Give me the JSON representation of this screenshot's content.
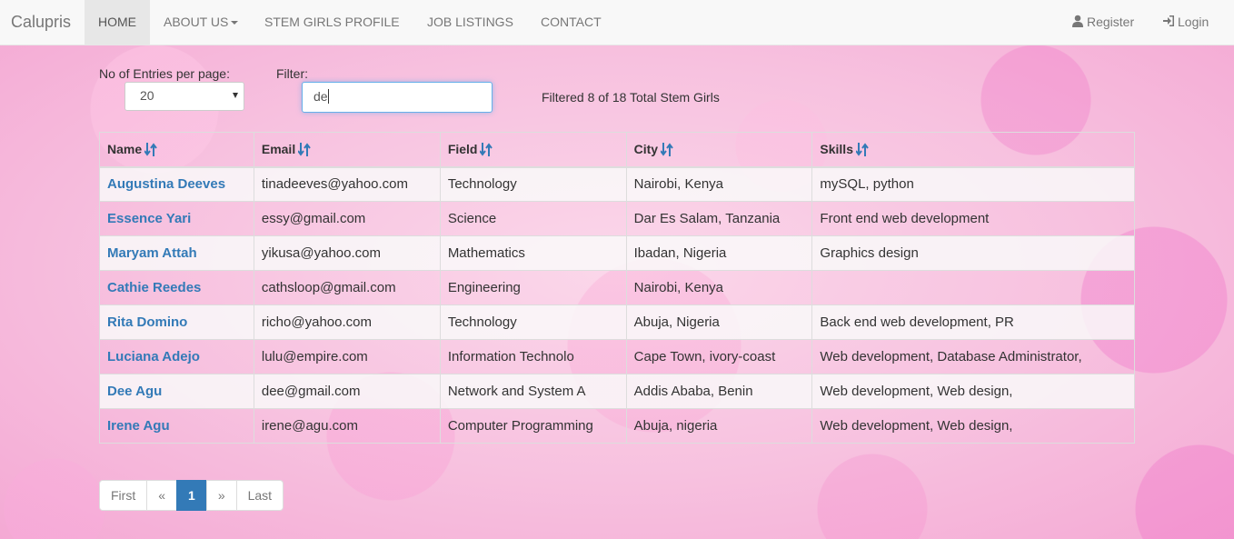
{
  "navbar": {
    "brand": "Calupris",
    "items": [
      {
        "label": "HOME"
      },
      {
        "label": "ABOUT US"
      },
      {
        "label": "STEM GIRLS PROFILE"
      },
      {
        "label": "JOB LISTINGS"
      },
      {
        "label": "CONTACT"
      }
    ],
    "register_label": "Register",
    "register_icon": "user-icon",
    "login_label": "Login",
    "login_icon": "sign-in-icon"
  },
  "controls": {
    "entries_label": "No of Entries per page:",
    "entries_value": "20",
    "filter_label": "Filter:",
    "filter_value": "de",
    "status": "Filtered 8 of 18 Total Stem Girls"
  },
  "table": {
    "headers": [
      "Name",
      "Email",
      "Field",
      "City",
      "Skills"
    ],
    "sort_icon": "sort-icon",
    "rows": [
      {
        "name": "Augustina Deeves",
        "email": "tinadeeves@yahoo.com",
        "field": "Technology",
        "city": "Nairobi, Kenya",
        "skills": "mySQL, python"
      },
      {
        "name": "Essence Yari",
        "email": "essy@gmail.com",
        "field": "Science",
        "city": "Dar Es Salam, Tanzania",
        "skills": "Front end web development"
      },
      {
        "name": "Maryam Attah",
        "email": "yikusa@yahoo.com",
        "field": "Mathematics",
        "city": "Ibadan, Nigeria",
        "skills": "Graphics design"
      },
      {
        "name": "Cathie Reedes",
        "email": "cathsloop@gmail.com",
        "field": "Engineering",
        "city": "Nairobi, Kenya",
        "skills": ""
      },
      {
        "name": "Rita Domino",
        "email": "richo@yahoo.com",
        "field": "Technology",
        "city": "Abuja, Nigeria",
        "skills": "Back end web development, PR"
      },
      {
        "name": "Luciana Adejo",
        "email": "lulu@empire.com",
        "field": "Information Technolo",
        "city": "Cape Town, ivory-coast",
        "skills": "Web development, Database Administrator,"
      },
      {
        "name": "Dee Agu",
        "email": "dee@gmail.com",
        "field": "Network and System A",
        "city": "Addis Ababa, Benin",
        "skills": "Web development, Web design,"
      },
      {
        "name": "Irene Agu",
        "email": "irene@agu.com",
        "field": "Computer Programming",
        "city": "Abuja, nigeria",
        "skills": "Web development, Web design,"
      }
    ]
  },
  "pagination": {
    "first": "First",
    "prev": "«",
    "current": "1",
    "next": "»",
    "last": "Last"
  },
  "colors": {
    "link": "#337ab7",
    "active_page": "#337ab7",
    "navbar_bg": "#f8f8f8",
    "input_focus": "#66afe9"
  }
}
